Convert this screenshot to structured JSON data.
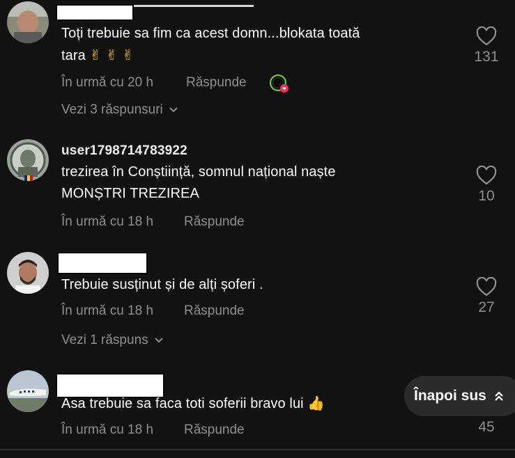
{
  "comments": [
    {
      "text_line1": "Toți trebuie sa fim ca acest domn...blokata toată",
      "text_line2": "tara",
      "emoji": "✌ ✌ ✌",
      "time": "În urmă cu 20 h",
      "reply": "Răspunde",
      "likes": "131",
      "view_replies": "Vezi 3 răspunsuri"
    },
    {
      "username": "user1798714783922",
      "text_line1": "trezirea în Conștiință, somnul național naște",
      "text_line2": "MONȘTRI TREZIREA",
      "time": "În urmă cu 18 h",
      "reply": "Răspunde",
      "likes": "10"
    },
    {
      "text_line1": "Trebuie susținut și de alți șoferi .",
      "time": "În urmă cu 18 h",
      "reply": "Răspunde",
      "likes": "27",
      "view_replies": "Vezi 1 răspuns"
    },
    {
      "text_line1": "Asa trebuie sa faca toti soferii bravo lui",
      "emoji": "👍",
      "time": "În urmă cu 18 h",
      "reply": "Răspunde",
      "likes": "45"
    }
  ],
  "back_to_top": "Înapoi sus",
  "icons": {
    "like": "heart-outline-icon",
    "expand": "chevron-down-icon",
    "creator": "creator-liked-icon",
    "back_to_top": "chevrons-up-icon"
  },
  "colors": {
    "background": "#121212",
    "text": "#ffffff",
    "muted": "#8f8f8f",
    "accent_heart": "#fe2c55"
  }
}
